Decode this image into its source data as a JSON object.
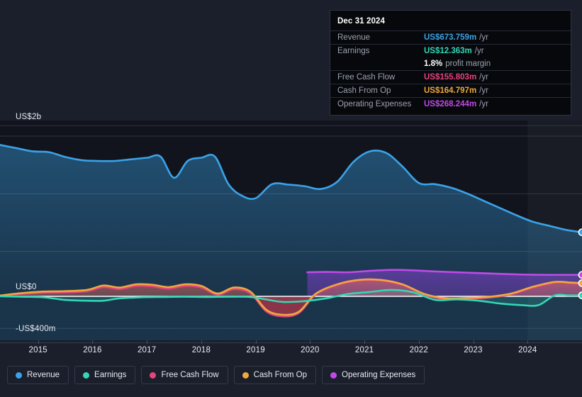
{
  "tooltip": {
    "date": "Dec 31 2024",
    "rows": [
      {
        "key": "Revenue",
        "value": "US$673.759m",
        "suffix": "/yr",
        "color": "#3aa3e8"
      },
      {
        "key": "Earnings",
        "value": "US$12.363m",
        "suffix": "/yr",
        "color": "#33d6b6"
      },
      {
        "key": "",
        "value": "1.8%",
        "suffix": "profit margin",
        "color": "#ffffff"
      },
      {
        "key": "Free Cash Flow",
        "value": "US$155.803m",
        "suffix": "/yr",
        "color": "#e5447e"
      },
      {
        "key": "Cash From Op",
        "value": "US$164.797m",
        "suffix": "/yr",
        "color": "#efa93c"
      },
      {
        "key": "Operating Expenses",
        "value": "US$268.244m",
        "suffix": "/yr",
        "color": "#c04ae8"
      }
    ]
  },
  "axis": {
    "y_top_label": "US$2b",
    "y_zero_label": "US$0",
    "y_bottom_label": "-US$400m",
    "x_labels": [
      "2015",
      "2016",
      "2017",
      "2018",
      "2019",
      "2020",
      "2021",
      "2022",
      "2023",
      "2024"
    ]
  },
  "legend": {
    "items": [
      {
        "label": "Revenue",
        "color": "#3aa3e8"
      },
      {
        "label": "Earnings",
        "color": "#33d6b6"
      },
      {
        "label": "Free Cash Flow",
        "color": "#e5447e"
      },
      {
        "label": "Cash From Op",
        "color": "#efa93c"
      },
      {
        "label": "Operating Expenses",
        "color": "#c04ae8"
      }
    ]
  },
  "chart_data": {
    "type": "area",
    "title": "",
    "xlabel": "",
    "ylabel": "",
    "ylim": [
      -400,
      2000
    ],
    "y_unit": "US$ millions",
    "grid": true,
    "legend_position": "bottom",
    "x_tick_years": [
      2015,
      2016,
      2017,
      2018,
      2019,
      2020,
      2021,
      2022,
      2023,
      2024
    ],
    "x_domain": [
      2014.3,
      2025.0
    ],
    "forecast_region_start": 2024.0,
    "series": [
      {
        "name": "Revenue",
        "color": "#3aa3e8",
        "x": [
          2014.3,
          2014.6,
          2014.9,
          2015.2,
          2015.5,
          2015.8,
          2016.1,
          2016.4,
          2016.7,
          2017.0,
          2017.25,
          2017.5,
          2017.75,
          2018.0,
          2018.25,
          2018.5,
          2018.75,
          2019.0,
          2019.3,
          2019.6,
          2019.9,
          2020.2,
          2020.5,
          2020.8,
          2021.1,
          2021.4,
          2021.7,
          2022.0,
          2022.3,
          2022.6,
          2022.9,
          2023.2,
          2023.5,
          2023.8,
          2024.1,
          2024.4,
          2024.7,
          2025.0
        ],
        "y": [
          1890,
          1850,
          1810,
          1800,
          1740,
          1700,
          1690,
          1690,
          1710,
          1730,
          1745,
          1480,
          1690,
          1730,
          1745,
          1400,
          1255,
          1225,
          1400,
          1395,
          1375,
          1340,
          1430,
          1680,
          1810,
          1790,
          1620,
          1415,
          1400,
          1355,
          1280,
          1190,
          1100,
          1010,
          930,
          880,
          830,
          800
        ]
      },
      {
        "name": "Operating Expenses",
        "color": "#c04ae8",
        "x": [
          2019.95,
          2020.3,
          2020.7,
          2021.1,
          2021.5,
          2021.9,
          2022.3,
          2022.7,
          2023.1,
          2023.5,
          2023.9,
          2024.3,
          2024.7,
          2025.0
        ],
        "y": [
          300,
          305,
          300,
          318,
          330,
          325,
          310,
          300,
          290,
          280,
          272,
          268,
          268,
          268
        ]
      },
      {
        "name": "Cash From Op",
        "color": "#efa93c",
        "x": [
          2014.3,
          2014.7,
          2015.1,
          2015.5,
          2015.9,
          2016.2,
          2016.5,
          2016.8,
          2017.1,
          2017.4,
          2017.7,
          2018.0,
          2018.3,
          2018.6,
          2018.9,
          2019.2,
          2019.5,
          2019.8,
          2020.1,
          2020.5,
          2020.9,
          2021.3,
          2021.7,
          2022.1,
          2022.5,
          2022.9,
          2023.3,
          2023.7,
          2024.1,
          2024.5,
          2024.8,
          2025.0
        ],
        "y": [
          10,
          40,
          60,
          65,
          80,
          135,
          110,
          150,
          145,
          115,
          150,
          130,
          35,
          110,
          60,
          -170,
          -230,
          -190,
          30,
          150,
          205,
          205,
          150,
          30,
          -25,
          -20,
          -5,
          35,
          120,
          180,
          172,
          165
        ]
      },
      {
        "name": "Free Cash Flow",
        "color": "#e5447e",
        "x": [
          2014.3,
          2014.7,
          2015.1,
          2015.5,
          2015.9,
          2016.2,
          2016.5,
          2016.8,
          2017.1,
          2017.4,
          2017.7,
          2018.0,
          2018.3,
          2018.6,
          2018.9,
          2019.2,
          2019.5,
          2019.8,
          2020.1,
          2020.5,
          2020.9,
          2021.3,
          2021.7,
          2022.1,
          2022.5,
          2022.9,
          2023.3,
          2023.7,
          2024.1,
          2024.5,
          2024.8,
          2025.0
        ],
        "y": [
          5,
          30,
          45,
          50,
          65,
          115,
          90,
          130,
          125,
          95,
          130,
          110,
          20,
          90,
          40,
          -190,
          -250,
          -205,
          20,
          140,
          195,
          195,
          140,
          20,
          -35,
          -30,
          -15,
          25,
          110,
          170,
          162,
          156
        ]
      },
      {
        "name": "Earnings",
        "color": "#33d6b6",
        "x": [
          2014.3,
          2014.7,
          2015.1,
          2015.5,
          2015.9,
          2016.2,
          2016.5,
          2016.9,
          2017.3,
          2017.7,
          2018.1,
          2018.5,
          2018.9,
          2019.2,
          2019.5,
          2019.9,
          2020.3,
          2020.7,
          2021.1,
          2021.5,
          2021.9,
          2022.3,
          2022.7,
          2023.1,
          2023.5,
          2023.9,
          2024.2,
          2024.5,
          2024.75,
          2025.0
        ],
        "y": [
          0,
          -5,
          -12,
          -45,
          -55,
          -55,
          -25,
          -12,
          -8,
          -5,
          -8,
          -5,
          -8,
          -40,
          -70,
          -60,
          -25,
          30,
          55,
          80,
          50,
          -45,
          -38,
          -55,
          -90,
          -110,
          -110,
          12,
          12,
          12
        ]
      }
    ],
    "endpoints": [
      {
        "series": "Revenue",
        "x": 2025.0,
        "y": 800,
        "color": "#3aa3e8"
      },
      {
        "series": "Operating Expenses",
        "x": 2025.0,
        "y": 268,
        "color": "#c04ae8"
      },
      {
        "series": "Cash From Op",
        "x": 2025.0,
        "y": 165,
        "color": "#efa93c"
      },
      {
        "series": "Earnings",
        "x": 2025.0,
        "y": 12,
        "color": "#33d6b6"
      }
    ]
  }
}
